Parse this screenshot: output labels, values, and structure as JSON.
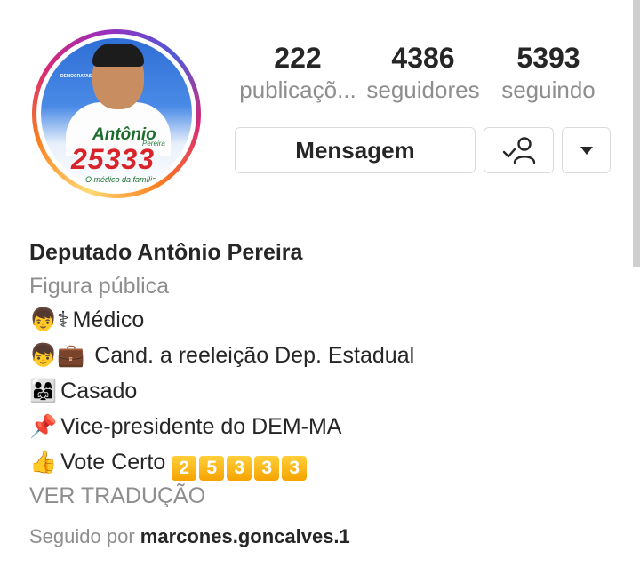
{
  "profile": {
    "avatar_icon": "campaign-profile-photo",
    "avatar_text": {
      "small": "DEMOCRATAS",
      "name": "Antônio",
      "surname": "Pereira",
      "number": "25333",
      "slogan": "O médico da família"
    },
    "stats": [
      {
        "value": "222",
        "label": "publicaçõ..."
      },
      {
        "value": "4386",
        "label": "seguidores"
      },
      {
        "value": "5393",
        "label": "seguindo"
      }
    ],
    "buttons": {
      "message_label": "Mensagem",
      "following_icon": "following-check-person-icon",
      "more_icon": "caret-down-icon"
    }
  },
  "bio": {
    "name": "Deputado Antônio Pereira",
    "category": "Figura pública",
    "lines": [
      {
        "emoji": "👦⚕",
        "text": "Médico"
      },
      {
        "emoji": "👦💼",
        "text": " Cand. a reeleição Dep. Estadual"
      },
      {
        "emoji": "👨‍👩‍👧",
        "text": "Casado"
      },
      {
        "emoji": "📌",
        "text": "Vice-presidente do DEM-MA"
      },
      {
        "emoji": "👍",
        "text": "Vote Certo ",
        "digits": [
          "2",
          "5",
          "3",
          "3",
          "3"
        ]
      }
    ],
    "translate": "VER TRADUÇÃO",
    "followed_prefix": "Seguido por ",
    "followed_user": "marcones.goncalves.1"
  },
  "colors": {
    "primary_text": "#262626",
    "secondary_text": "#8e8e8e",
    "border": "#dbdbdb",
    "digit_box": "#f5a300"
  }
}
